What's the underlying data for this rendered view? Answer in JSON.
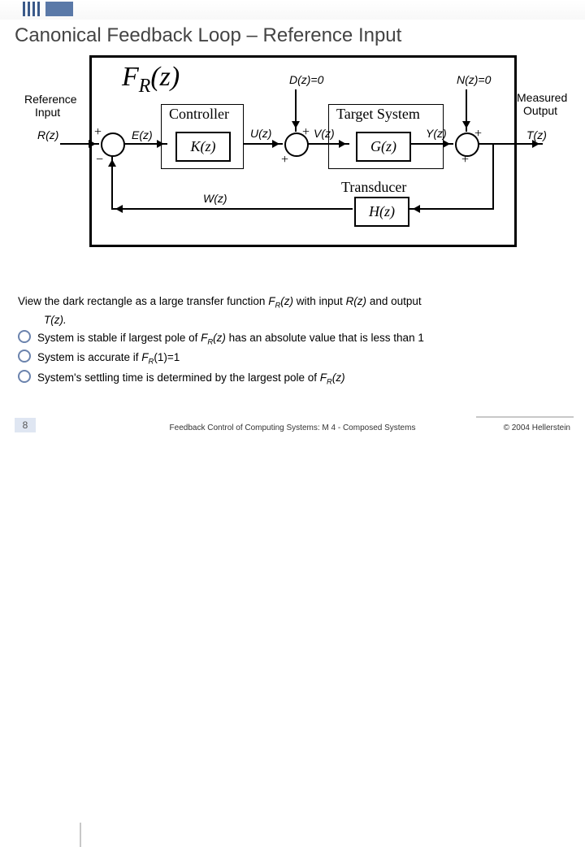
{
  "title": "Canonical Feedback Loop – Reference Input",
  "left_label_1": "Reference",
  "left_label_2": "Input",
  "right_label_1": "Measured",
  "right_label_2": "Output",
  "fr_pre": "F",
  "fr_sub": "R",
  "fr_arg": "(z)",
  "sig": {
    "R": "R(z)",
    "E": "E(z)",
    "U": "U(z)",
    "D": "D(z)=0",
    "V": "V(z)",
    "Y": "Y(z)",
    "N": "N(z)=0",
    "T": "T(z)",
    "W": "W(z)"
  },
  "boxes": {
    "controller_title": "Controller",
    "target_title": "Target System",
    "transducer_title": "Transducer",
    "K": "K(z)",
    "G": "G(z)",
    "H": "H(z)"
  },
  "signs": {
    "p": "+",
    "m": "−"
  },
  "notes": {
    "l1a": "View the dark rectangle as a large transfer function ",
    "l1b": " with input ",
    "l1c": " and output",
    "l2": "T(z).",
    "b1a": "System is stable if largest pole of ",
    "b1b": " has an absolute value that is less than 1",
    "b2a": "System is accurate if ",
    "b2b": "(1)=1",
    "b3a": "System's settling time is determined by the largest pole of "
  },
  "footer": {
    "page": "8",
    "center": "Feedback Control of Computing Systems: M 4 - Composed Systems",
    "right": "© 2004 Hellerstein"
  }
}
